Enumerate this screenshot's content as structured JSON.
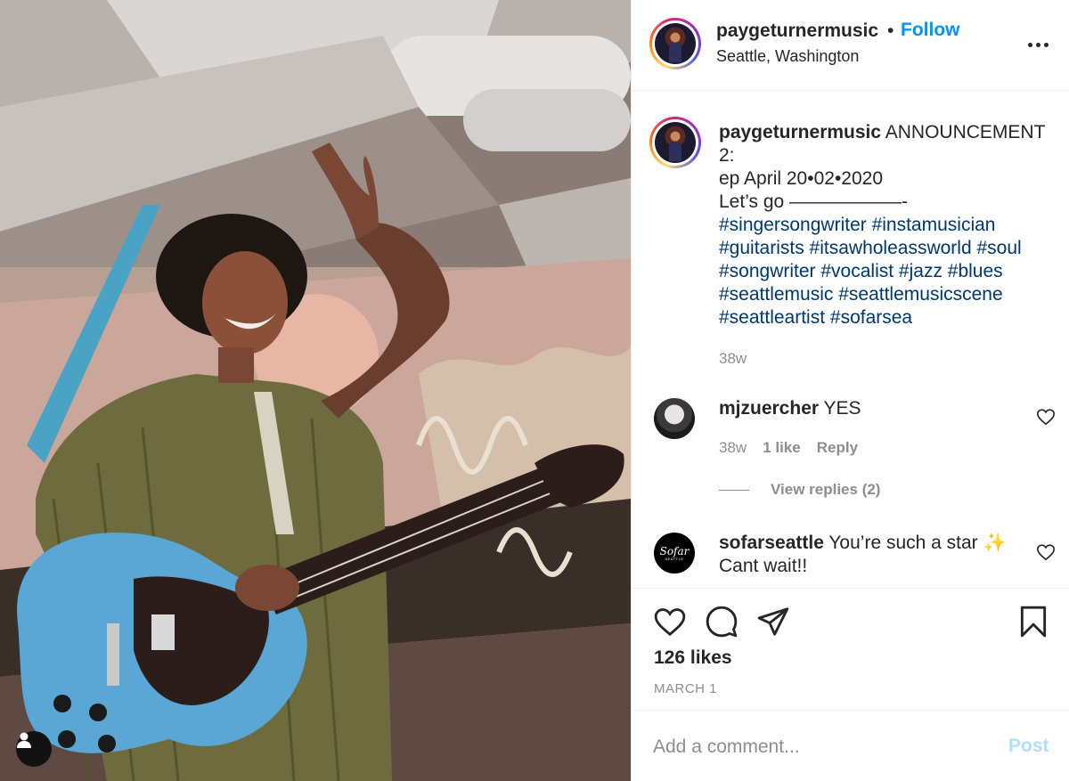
{
  "post": {
    "username": "paygeturnermusic",
    "separator": "•",
    "follow_label": "Follow",
    "location": "Seattle, Washington",
    "more_icon": "more-horizontal-icon",
    "photo_alt": "Musician with blue electric guitar waving on stage"
  },
  "caption": {
    "username": "paygeturnermusic",
    "text_line1": " ANNOUNCEMENT 2:",
    "text_line2": "ep April 20•02•2020",
    "text_line3": "Let’s go ——————-",
    "hashtags": [
      "#singersongwriter #instamusician",
      "#guitarists #itsawholeassworld #soul",
      "#songwriter #vocalist #jazz #blues",
      "#seattlemusic #seattlemusicscene",
      "#seattleartist #sofarsea"
    ],
    "time": "38w"
  },
  "comments": [
    {
      "username": "mjzuercher",
      "text": " YES",
      "time": "38w",
      "likes": "1 like",
      "reply_label": "Reply",
      "view_replies": "View replies (2)"
    },
    {
      "username": "sofarseattle",
      "text": " You’re such a star ",
      "emoji": "✨",
      "text2": "Cant wait!!",
      "avatar_logo": "Sofar",
      "avatar_sub": "SEATTLE"
    }
  ],
  "actions": {
    "like_icon": "heart-icon",
    "comment_icon": "comment-icon",
    "share_icon": "share-icon",
    "save_icon": "bookmark-icon"
  },
  "likes": "126 likes",
  "date": "MARCH 1",
  "comment_box": {
    "placeholder": "Add a comment...",
    "post_label": "Post"
  },
  "colors": {
    "accent": "#0095f6",
    "hashtag": "#00376b",
    "muted": "#8e8e8e",
    "post_disabled": "#b2dffc",
    "guitar_blue": "#5aa7d6"
  }
}
